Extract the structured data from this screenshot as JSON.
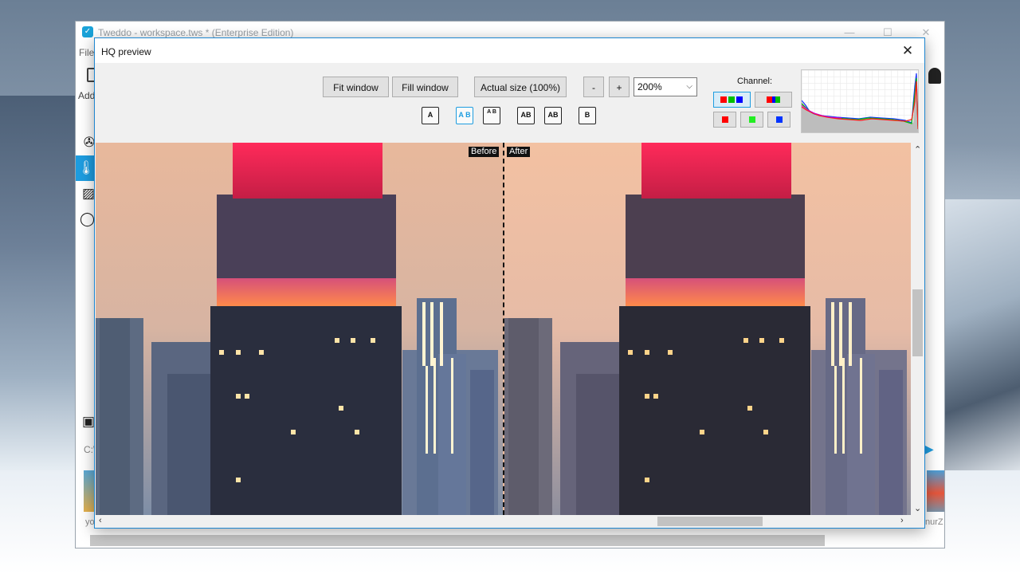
{
  "app": {
    "title": "Tweddo - workspace.tws * (Enterprise Edition)",
    "menu_file": "File",
    "add_label": "Add",
    "path_fragment": "C:\\",
    "thumb_left_label": "yo",
    "thumb_right_label": "nurZ",
    "window_controls": [
      "—",
      "☐",
      "✕"
    ]
  },
  "dialog": {
    "title": "HQ preview",
    "close_glyph": "✕",
    "buttons": {
      "fit_window": "Fit window",
      "fill_window": "Fill window",
      "actual_size": "Actual size (100%)",
      "zoom_out": "-",
      "zoom_in": "+"
    },
    "zoom": {
      "value": "200%",
      "options_visible": [
        "200%"
      ]
    },
    "view_modes": [
      {
        "id": "a-only",
        "glyph": "A",
        "selected": false
      },
      {
        "id": "side-by-side",
        "glyph": "A B",
        "selected": true
      },
      {
        "id": "stacked",
        "glyph": "A B",
        "selected": false
      },
      {
        "id": "split-vertical",
        "glyph": "AB",
        "selected": false
      },
      {
        "id": "split-horizontal",
        "glyph": "AB",
        "selected": false
      },
      {
        "id": "b-only",
        "glyph": "B",
        "selected": false
      }
    ],
    "channel": {
      "label": "Channel:",
      "options": [
        {
          "id": "rgb",
          "colors": [
            "#ff0000",
            "#00c000",
            "#0000ff"
          ],
          "selected": true
        },
        {
          "id": "rgb-alt",
          "colors": [
            "#ff0000",
            "#0000ff",
            "#00c000"
          ],
          "selected": false
        },
        {
          "id": "red",
          "colors": [
            "#ff0000"
          ],
          "selected": false
        },
        {
          "id": "green",
          "colors": [
            "#22ee22"
          ],
          "selected": false
        },
        {
          "id": "blue",
          "colors": [
            "#0033ff"
          ],
          "selected": false
        }
      ]
    },
    "preview": {
      "before_label": "Before",
      "after_label": "After"
    },
    "colors": {
      "accent": "#1e9de0",
      "dialog_border": "#1e86d0"
    }
  }
}
